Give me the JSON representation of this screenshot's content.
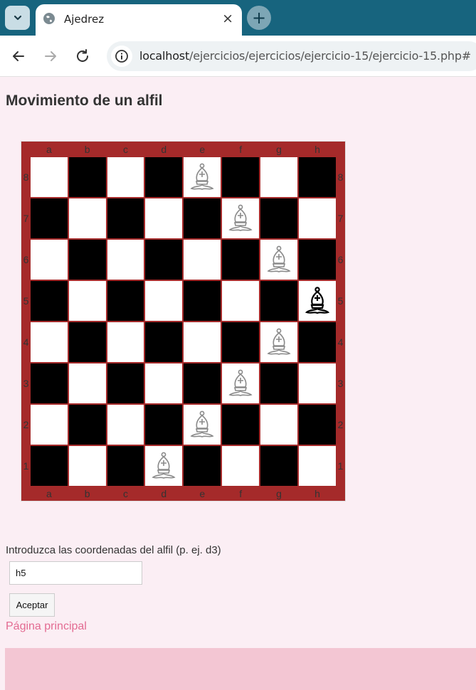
{
  "browser": {
    "tab_title": "Ajedrez",
    "close_glyph": "×",
    "new_tab_glyph": "+",
    "url_host": "localhost",
    "url_path": "/ejercicios/ejercicios/ejercicio-15/ejercicio-15.php#"
  },
  "page": {
    "title": "Movimiento de un alfil",
    "prompt_label": "Introduzca las coordenadas del alfil (p. ej. d3)",
    "input_value": "h5",
    "accept_label": "Aceptar",
    "home_link": "Página principal"
  },
  "board": {
    "columns": [
      "a",
      "b",
      "c",
      "d",
      "e",
      "f",
      "g",
      "h"
    ],
    "rows": [
      "8",
      "7",
      "6",
      "5",
      "4",
      "3",
      "2",
      "1"
    ],
    "colors": {
      "light": "#ffffff",
      "dark": "#000000",
      "frame": "#a52a2a"
    },
    "bishop": {
      "square": "h5",
      "icon": "bishop-icon"
    },
    "moves": [
      "e8",
      "f7",
      "g6",
      "g4",
      "f3",
      "e2",
      "d1"
    ]
  }
}
